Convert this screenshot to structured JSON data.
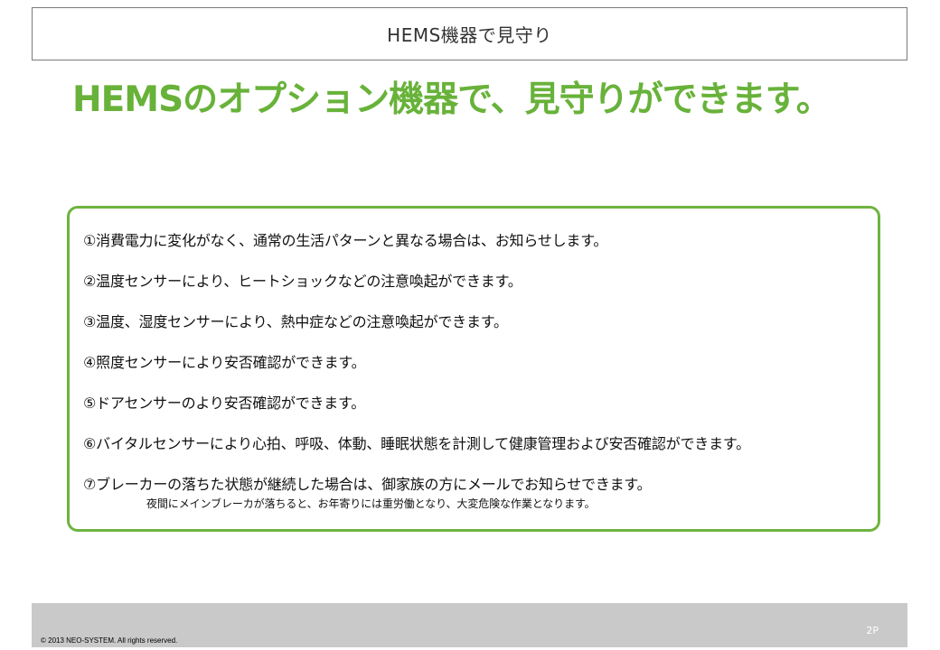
{
  "header": {
    "title": "HEMS機器で見守り"
  },
  "headline": "HEMSのオプション機器で、見守りができます。",
  "list": {
    "items": [
      "①消費電力に変化がなく、通常の生活パターンと異なる場合は、お知らせします。",
      "②温度センサーにより、ヒートショックなどの注意喚起ができます。",
      "③温度、湿度センサーにより、熱中症などの注意喚起ができます。",
      "④照度センサーにより安否確認ができます。",
      "⑤ドアセンサーのより安否確認ができます。",
      "⑥バイタルセンサーにより心拍、呼吸、体動、睡眠状態を計測して健康管理および安否確認ができます。",
      "⑦ブレーカーの落ちた状態が継続した場合は、御家族の方にメールでお知らせできます。"
    ],
    "note": "夜間にメインブレーカが落ちると、お年寄りには重労働となり、大変危険な作業となります。"
  },
  "footer": {
    "page_number": "2P",
    "copyright": "© 2013 NEO-SYSTEM. All rights reserved."
  },
  "colors": {
    "accent": "#68b23a",
    "footer": "#c9c9c9"
  }
}
